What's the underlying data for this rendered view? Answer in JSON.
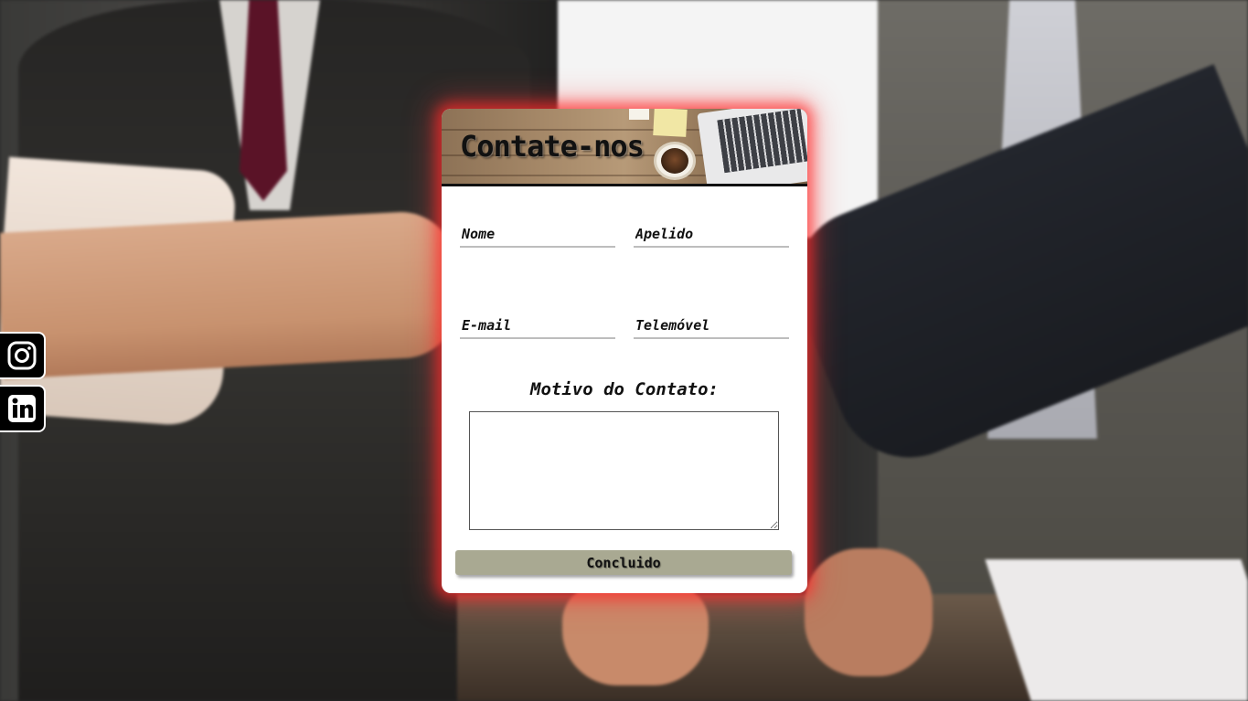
{
  "form": {
    "title": "Contate-nos",
    "fields": {
      "nome_placeholder": "Nome",
      "apelido_placeholder": "Apelido",
      "email_placeholder": "E-mail",
      "telemovel_placeholder": "Telemóvel"
    },
    "motivo_label": "Motivo do Contato:",
    "motivo_value": "",
    "submit_label": "Concluido"
  },
  "social": [
    {
      "icon": "instagram-icon"
    },
    {
      "icon": "linkedin-icon"
    }
  ],
  "colors": {
    "glow": "#ff2828",
    "button": "#a9a992",
    "card": "#ffffff"
  }
}
